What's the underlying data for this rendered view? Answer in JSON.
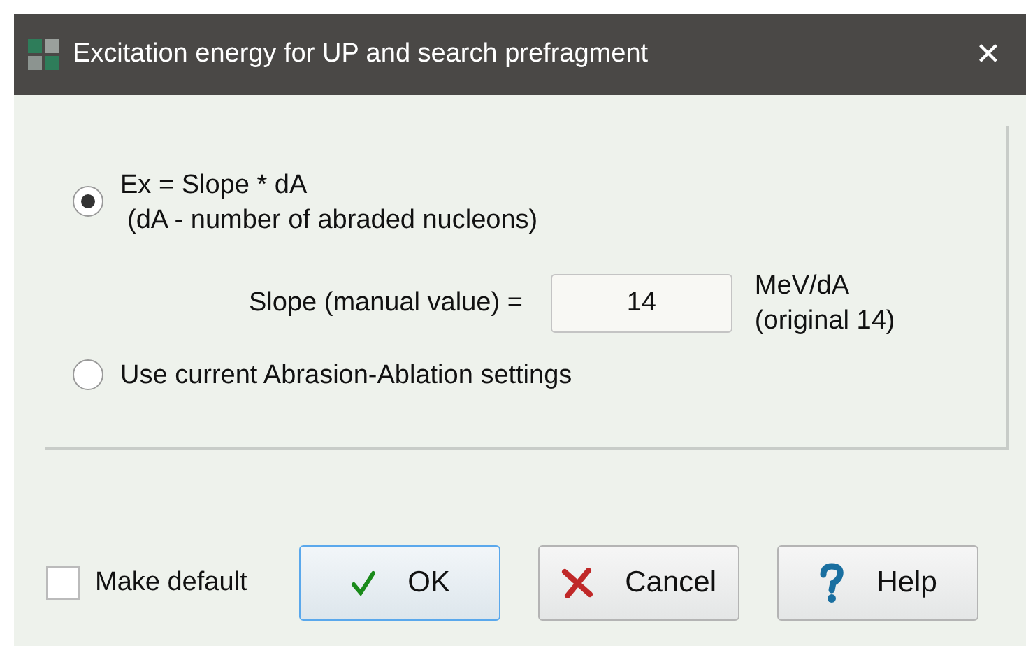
{
  "window": {
    "title": "Excitation energy for UP and search prefragment",
    "close": "✕"
  },
  "options": [
    {
      "kind": "radio",
      "label": "Ex = Slope * dA",
      "note": "(dA - number of abraded nucleons)",
      "selected": true
    },
    {
      "kind": "field",
      "label": "Slope (manual value) =",
      "value": "14",
      "unit": "MeV/dA",
      "original": "(original 14)"
    },
    {
      "kind": "radio",
      "label": "Use current Abrasion-Ablation settings",
      "selected": false
    }
  ],
  "make_default": {
    "label": "Make default",
    "checked": false
  },
  "buttons": [
    {
      "kind": "ok",
      "label": "OK",
      "focused": true
    },
    {
      "kind": "cancel",
      "label": "Cancel",
      "focused": false
    },
    {
      "kind": "help",
      "label": "Help",
      "focused": false
    }
  ]
}
